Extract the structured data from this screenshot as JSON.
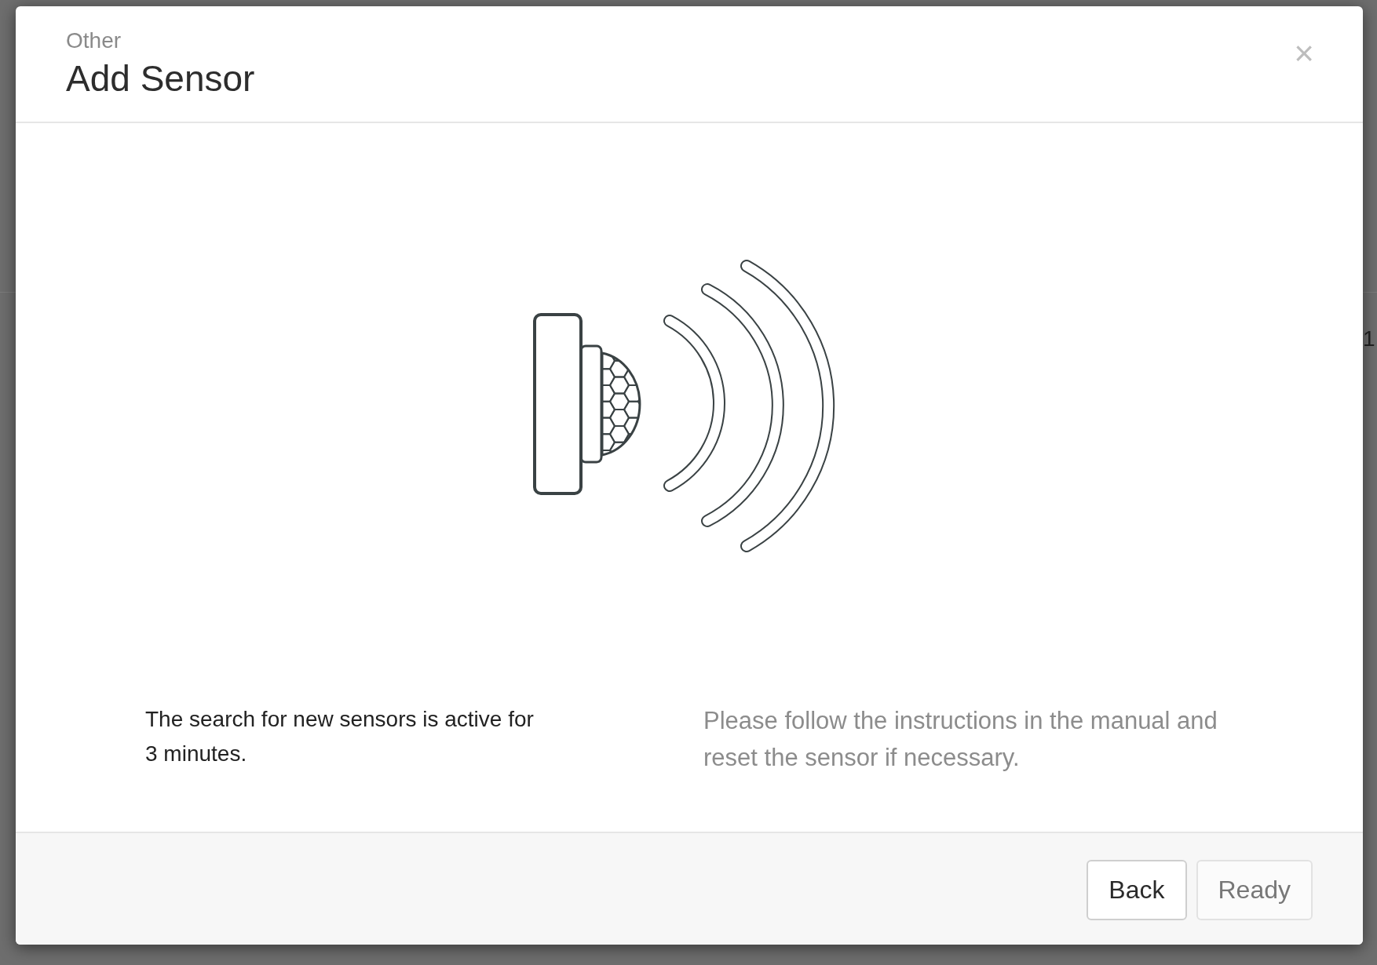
{
  "background": {
    "text": "1"
  },
  "dialog": {
    "subtitle": "Other",
    "title": "Add Sensor",
    "close": "×",
    "info_text": "The search for new sensors is active for 3 minutes.",
    "hint_text": "Please follow the instructions in the manual and reset the sensor if necessary.",
    "buttons": [
      {
        "label": "Back",
        "disabled": false
      },
      {
        "label": "Ready",
        "disabled": true
      }
    ]
  }
}
